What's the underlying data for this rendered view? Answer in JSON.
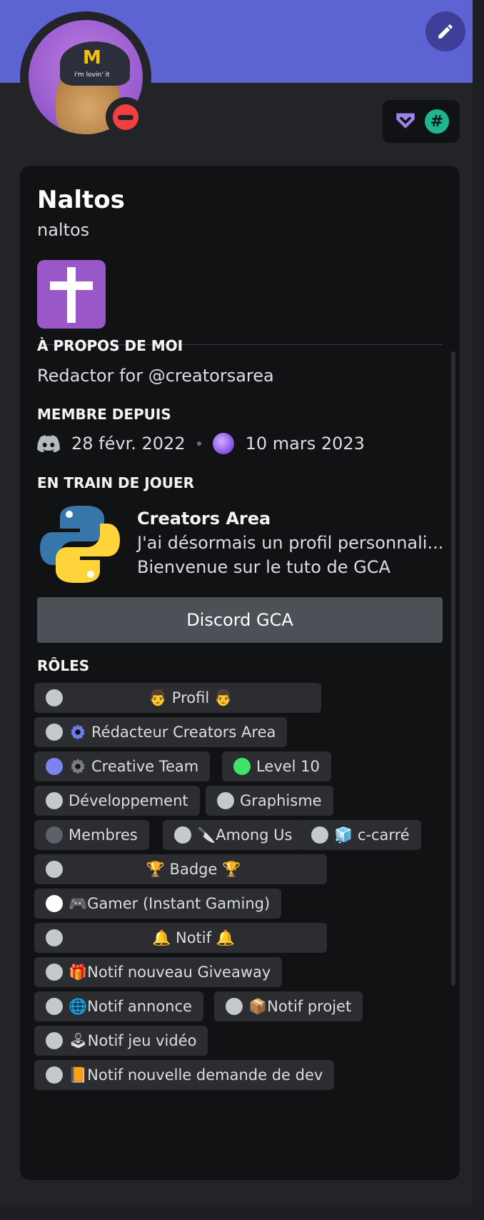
{
  "profile": {
    "display_name": "Naltos",
    "username": "naltos",
    "status": "dnd",
    "avatar_cap_logo": "M",
    "avatar_cap_text": "i'm lovin' it"
  },
  "sections": {
    "about_title": "À PROPOS DE MOI",
    "about_text": "Redactor for @creatorsarea",
    "member_since_title": "MEMBRE DEPUIS",
    "member_discord_date": "28 févr. 2022",
    "member_server_date": "10 mars 2023",
    "playing_title": "EN TRAIN DE JOUER",
    "roles_title": "RÔLES"
  },
  "activity": {
    "name": "Creators Area",
    "details": "J'ai désormais un profil personnali...",
    "state": "Bienvenue sur le tuto de GCA",
    "button_label": "Discord GCA"
  },
  "badges": {
    "hash_symbol": "#"
  },
  "roles": [
    {
      "label": "👨 Profil 👨",
      "dot": "#c4c9ce"
    },
    {
      "label": "Rédacteur Creators Area",
      "dot": "#c4c9ce"
    },
    {
      "label": "Creative Team",
      "dot": "#7b83ec"
    },
    {
      "label": "Level 10",
      "dot": "#3fe36a"
    },
    {
      "label": "Développement",
      "dot": "#c4c9ce"
    },
    {
      "label": "Graphisme",
      "dot": "#c4c9ce"
    },
    {
      "label": "Membres",
      "dot": "#5e6168"
    },
    {
      "label": "🔪Among Us",
      "dot": "#c4c9ce"
    },
    {
      "label": "🧊 c-carré",
      "dot": "#c4c9ce"
    },
    {
      "label": "🏆 Badge 🏆",
      "dot": "#c4c9ce"
    },
    {
      "label": "🎮Gamer (Instant Gaming)",
      "dot": "#ffffff"
    },
    {
      "label": "🔔 Notif 🔔",
      "dot": "#c4c9ce"
    },
    {
      "label": "🎁Notif nouveau Giveaway",
      "dot": "#c4c9ce"
    },
    {
      "label": "🌐Notif annonce",
      "dot": "#c4c9ce"
    },
    {
      "label": "📦Notif projet",
      "dot": "#c4c9ce"
    },
    {
      "label": "🕹Notif jeu vidéo",
      "dot": "#c4c9ce"
    },
    {
      "label": "📙Notif nouvelle demande de dev",
      "dot": "#c4c9ce"
    }
  ],
  "colors": {
    "banner": "#5c64d4",
    "card": "#111214",
    "background": "#232428"
  }
}
